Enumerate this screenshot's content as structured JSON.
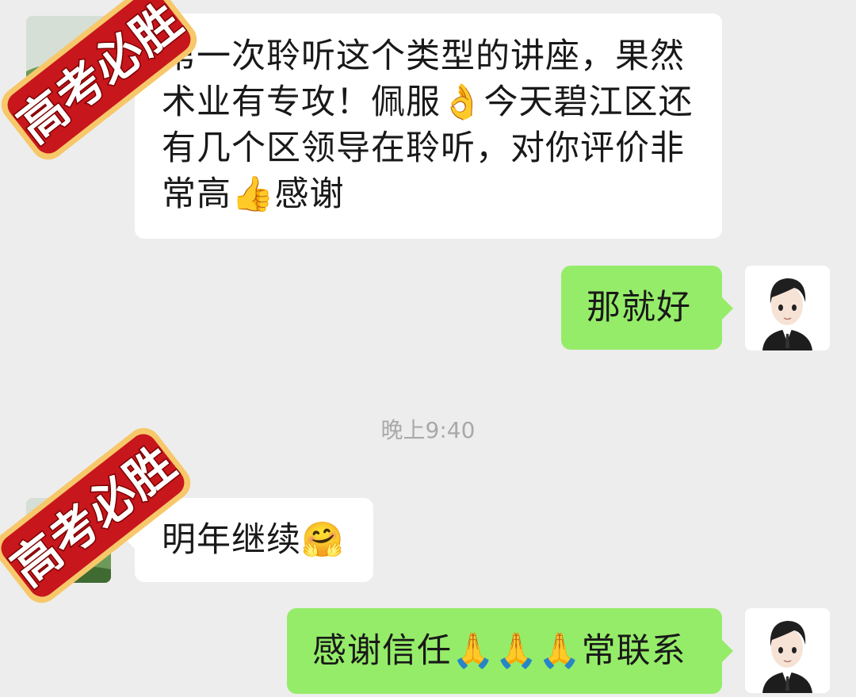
{
  "messages": [
    {
      "sender": "contact",
      "text": "第一次聆听这个类型的讲座，果然\n术业有专攻！佩服👌今天碧江区还\n有几个区领导在聆听，对你评价非\n常高👍感谢"
    },
    {
      "sender": "self",
      "text": "那就好"
    },
    {
      "sender": "contact",
      "text": "明年继续🤗"
    },
    {
      "sender": "self",
      "text": "感谢信任🙏🙏🙏常联系"
    }
  ],
  "timestamp": "晚上9:40",
  "overlay": {
    "badge_text": "高考必胜",
    "badge_color": "#c8161d",
    "badge_border_color": "#f7c86a"
  },
  "colors": {
    "background": "#ededed",
    "incoming_bubble": "#ffffff",
    "outgoing_bubble": "#95ec69"
  },
  "icons": {
    "contact_avatar": "contact-avatar-icon",
    "self_avatar": "cartoon-man-avatar-icon"
  }
}
